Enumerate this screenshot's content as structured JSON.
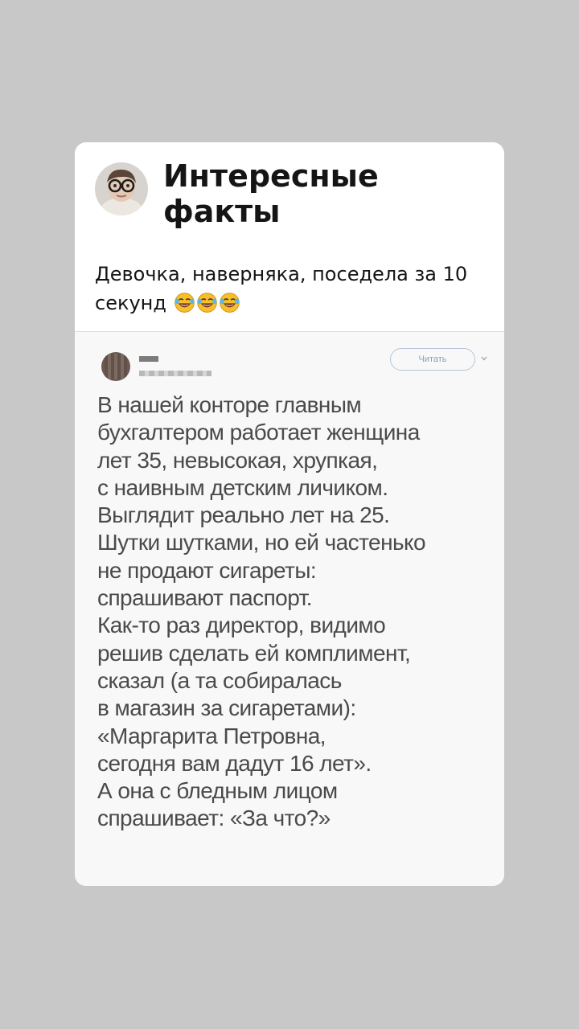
{
  "post": {
    "channel_name": "Интересные факты",
    "caption": "Девочка, наверняка, поседела за 10 секунд",
    "caption_emoji": [
      "face-with-tears-of-joy",
      "face-with-tears-of-joy",
      "face-with-tears-of-joy"
    ]
  },
  "tweet": {
    "follow_label": "Читать",
    "lines": [
      "В нашей конторе главным",
      "бухгалтером работает женщина",
      "лет 35, невысокая, хрупкая,",
      "с наивным детским личиком.",
      "Выглядит реально лет на 25.",
      "Шутки шутками, но ей частенько",
      "не продают сигареты:",
      "спрашивают паспорт.",
      "Как-то раз директор, видимо",
      "решив сделать ей комплимент,",
      "сказал (а та собиралась",
      "в магазин за сигаретами):",
      "«Маргарита Петровна,",
      "сегодня вам дадут 16 лет».",
      "А она с бледным лицом",
      "спрашивает: «За что?»"
    ]
  },
  "colors": {
    "background": "#c8c8c8",
    "card": "#ffffff",
    "tweet_text": "#4a4a4a",
    "follow_outline": "#b5c7d8"
  }
}
